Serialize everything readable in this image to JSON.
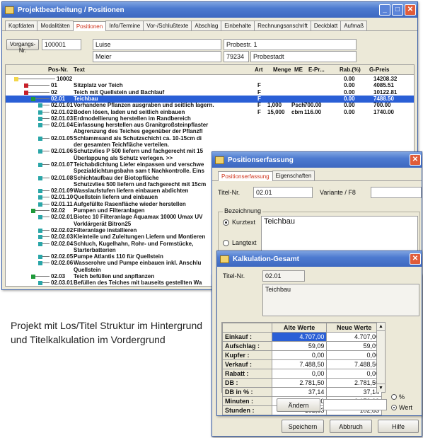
{
  "back_window": {
    "title": "Projektbearbeitung / Positionen",
    "tabs": [
      "Kopfdaten",
      "Modalitäten",
      "Positionen",
      "Info/Termine",
      "Vor-/Schlußtexte",
      "Abschlag",
      "Einbehalte",
      "Rechnungsanschrift",
      "Deckblatt",
      "Aufmaß"
    ],
    "active_tab": "Positionen",
    "vorgang_button": "Vorgangs-Nr.",
    "vorgang_nr": "100001",
    "name1": "Luise",
    "name2": "Meier",
    "strasse": "Probestr. 1",
    "plz": "79234",
    "ort": "Probestadt",
    "columns": [
      "Pos-Nr.",
      "Text",
      "Art",
      "Menge",
      "ME",
      "E-Pr...",
      "Rab.(%)",
      "G-Preis"
    ],
    "rows": [
      {
        "pos": "10002",
        "text": "",
        "art": "",
        "menge": "",
        "me": "",
        "epr": "",
        "rab": "0.00",
        "gpreis": "14208.32",
        "marker": "yellow",
        "indent": 0
      },
      {
        "pos": "01",
        "text": "Sitzplatz vor Teich",
        "art": "F",
        "menge": "",
        "me": "",
        "epr": "",
        "rab": "0.00",
        "gpreis": "4085.51",
        "marker": "red",
        "indent": 1
      },
      {
        "pos": "02",
        "text": "Teich mit Quellstein und Bachlauf",
        "art": "F",
        "menge": "",
        "me": "",
        "epr": "",
        "rab": "0.00",
        "gpreis": "10122.81",
        "marker": "red",
        "indent": 1
      },
      {
        "pos": "02.01",
        "text": "Teichbau",
        "art": "F",
        "menge": "",
        "me": "",
        "epr": "",
        "rab": "0.00",
        "gpreis": "7488.50",
        "marker": "green",
        "indent": 2,
        "selected": true
      },
      {
        "pos": "02.01.01",
        "text": "Vorhandene Pflanzen ausgraben und seitlich lagern.",
        "art": "F",
        "menge": "1,000",
        "me": "Psch",
        "epr": "700.00",
        "rab": "0.00",
        "gpreis": "700.00",
        "marker": "teal",
        "indent": 3
      },
      {
        "pos": "02.01.02",
        "text": "Boden lösen, laden und seitlich einbauen",
        "art": "F",
        "menge": "15,000",
        "me": "cbm",
        "epr": "116.00",
        "rab": "0.00",
        "gpreis": "1740.00",
        "marker": "teal",
        "indent": 3
      },
      {
        "pos": "02.01.03",
        "text": "Erdmodellierung herstellen im Randbereich",
        "art": "",
        "menge": "",
        "me": "",
        "epr": "",
        "rab": "",
        "gpreis": "",
        "marker": "teal",
        "indent": 3
      },
      {
        "pos": "02.01.04",
        "text": "Einfassung herstellen aus Granitgroßsteinpflaster",
        "art": "",
        "menge": "",
        "me": "",
        "epr": "",
        "rab": "",
        "gpreis": "",
        "marker": "teal",
        "indent": 3
      },
      {
        "pos": "",
        "text": "Abgrenzung des Teiches gegenüber der Pflanzfl",
        "art": "",
        "menge": "",
        "me": "",
        "epr": "",
        "rab": "",
        "gpreis": "",
        "marker": "",
        "indent": 3
      },
      {
        "pos": "02.01.05",
        "text": "Schlammsand als Schutzschicht ca. 10-15cm di",
        "art": "",
        "menge": "",
        "me": "",
        "epr": "",
        "rab": "",
        "gpreis": "",
        "marker": "teal",
        "indent": 3
      },
      {
        "pos": "",
        "text": "der gesamten Teichfläche verteilen.",
        "art": "",
        "menge": "",
        "me": "",
        "epr": "",
        "rab": "",
        "gpreis": "",
        "marker": "",
        "indent": 3
      },
      {
        "pos": "02.01.06",
        "text": "Schutzvlies P 500 liefern und fachgerecht mit 15",
        "art": "",
        "menge": "",
        "me": "",
        "epr": "",
        "rab": "",
        "gpreis": "",
        "marker": "teal",
        "indent": 3
      },
      {
        "pos": "",
        "text": "Überlappung als Schutz verlegen. >>",
        "art": "",
        "menge": "",
        "me": "",
        "epr": "",
        "rab": "",
        "gpreis": "",
        "marker": "",
        "indent": 3
      },
      {
        "pos": "02.01.07",
        "text": "Teichabdichtung Liefer einpassen und verschwe",
        "art": "",
        "menge": "",
        "me": "",
        "epr": "",
        "rab": "",
        "gpreis": "",
        "marker": "teal",
        "indent": 3
      },
      {
        "pos": "",
        "text": "Spezialdichtungsbahn sam t Nachkontrolle. Eins",
        "art": "",
        "menge": "",
        "me": "",
        "epr": "",
        "rab": "",
        "gpreis": "",
        "marker": "",
        "indent": 3
      },
      {
        "pos": "02.01.08",
        "text": "Schichtaufbau der Biotopfläche",
        "art": "",
        "menge": "",
        "me": "",
        "epr": "",
        "rab": "",
        "gpreis": "",
        "marker": "teal",
        "indent": 3
      },
      {
        "pos": "",
        "text": "Schutzvlies 500 liefern und fachgerecht mit 15cm",
        "art": "",
        "menge": "",
        "me": "",
        "epr": "",
        "rab": "",
        "gpreis": "",
        "marker": "",
        "indent": 3
      },
      {
        "pos": "02.01.09",
        "text": "Wasslaufstufen liefern einbauen abdichten",
        "art": "",
        "menge": "",
        "me": "",
        "epr": "",
        "rab": "",
        "gpreis": "",
        "marker": "teal",
        "indent": 3
      },
      {
        "pos": "02.01.10",
        "text": "Quellstein liefern und einbauen",
        "art": "",
        "menge": "",
        "me": "",
        "epr": "",
        "rab": "",
        "gpreis": "",
        "marker": "teal",
        "indent": 3
      },
      {
        "pos": "02.01.11",
        "text": "Aufgefüllte Rasenfläche wieder herstellen",
        "art": "",
        "menge": "",
        "me": "",
        "epr": "",
        "rab": "",
        "gpreis": "",
        "marker": "teal",
        "indent": 3
      },
      {
        "pos": "02.02",
        "text": "Pumpen und Filteranlagen",
        "art": "",
        "menge": "",
        "me": "",
        "epr": "",
        "rab": "",
        "gpreis": "",
        "marker": "green",
        "indent": 2
      },
      {
        "pos": "02.02.01",
        "text": "Biotec 10 Filteranlage Aquamax 10000 Umax UV",
        "art": "",
        "menge": "",
        "me": "",
        "epr": "",
        "rab": "",
        "gpreis": "",
        "marker": "teal",
        "indent": 3
      },
      {
        "pos": "",
        "text": "Vorklärgerät Bitron25",
        "art": "",
        "menge": "",
        "me": "",
        "epr": "",
        "rab": "",
        "gpreis": "",
        "marker": "",
        "indent": 3
      },
      {
        "pos": "02.02.02",
        "text": "Filteranlage installieren",
        "art": "",
        "menge": "",
        "me": "",
        "epr": "",
        "rab": "",
        "gpreis": "",
        "marker": "teal",
        "indent": 3
      },
      {
        "pos": "02.02.03",
        "text": "Kleinteile und Zuleitungen Liefern und Montieren",
        "art": "",
        "menge": "",
        "me": "",
        "epr": "",
        "rab": "",
        "gpreis": "",
        "marker": "teal",
        "indent": 3
      },
      {
        "pos": "02.02.04",
        "text": "Schluch, Kugelhahn, Rohr- und Formstücke,",
        "art": "",
        "menge": "",
        "me": "",
        "epr": "",
        "rab": "",
        "gpreis": "",
        "marker": "teal",
        "indent": 3
      },
      {
        "pos": "",
        "text": "Starterbatterien",
        "art": "",
        "menge": "",
        "me": "",
        "epr": "",
        "rab": "",
        "gpreis": "",
        "marker": "",
        "indent": 3
      },
      {
        "pos": "02.02.05",
        "text": "Pumpe Atlantis 110 für Quellstein",
        "art": "",
        "menge": "",
        "me": "",
        "epr": "",
        "rab": "",
        "gpreis": "",
        "marker": "teal",
        "indent": 3
      },
      {
        "pos": "02.02.06",
        "text": "Wasserohre und Pumpe einbauen inkl. Anschlu",
        "art": "",
        "menge": "",
        "me": "",
        "epr": "",
        "rab": "",
        "gpreis": "",
        "marker": "teal",
        "indent": 3
      },
      {
        "pos": "",
        "text": "Quellstein",
        "art": "",
        "menge": "",
        "me": "",
        "epr": "",
        "rab": "",
        "gpreis": "",
        "marker": "",
        "indent": 3
      },
      {
        "pos": "02.03",
        "text": "Teich befüllen und anpflanzen",
        "art": "",
        "menge": "",
        "me": "",
        "epr": "",
        "rab": "",
        "gpreis": "",
        "marker": "green",
        "indent": 2
      },
      {
        "pos": "02.03.01",
        "text": "Befüllen des Teiches mit bauseits gestellten Wa",
        "art": "",
        "menge": "",
        "me": "",
        "epr": "",
        "rab": "",
        "gpreis": "",
        "marker": "teal",
        "indent": 3
      }
    ]
  },
  "pos_window": {
    "title": "Positionserfassung",
    "tabs": [
      "Positionserfassung",
      "Eigenschaften"
    ],
    "titel_nr_label": "Titel-Nr.",
    "titel_nr_value": "02.01",
    "variante_label": "Variante / F8",
    "bezeichnung_label": "Bezeichnung",
    "radio_kurztext": "Kurztext",
    "radio_langtext": "Langtext",
    "bezeichnung_value": "Teichbau"
  },
  "calc_window": {
    "title": "Kalkulation-Gesamt",
    "titel_nr_label": "Titel-Nr.",
    "titel_nr_value": "02.01",
    "text_value": "Teichbau",
    "col_alt": "Alte Werte",
    "col_neu": "Neue Werte",
    "rows": [
      {
        "label": "Einkauf :",
        "alt": "4.707,00",
        "neu": "4.707,00"
      },
      {
        "label": "Aufschlag :",
        "alt": "59,09",
        "neu": "59,09"
      },
      {
        "label": "Kupfer :",
        "alt": "0,00",
        "neu": "0,00"
      },
      {
        "label": "Verkauf :",
        "alt": "7.488,50",
        "neu": "7.488,50"
      },
      {
        "label": "Rabatt :",
        "alt": "0,00",
        "neu": "0,00"
      },
      {
        "label": "DB :",
        "alt": "2.781,50",
        "neu": "2.781,50"
      },
      {
        "label": "DB in % :",
        "alt": "37,14",
        "neu": "37,14"
      },
      {
        "label": "Minuten :",
        "alt": "6.170,00",
        "neu": "6.170,00"
      },
      {
        "label": "Stunden :",
        "alt": "102,83",
        "neu": "102,83"
      }
    ],
    "aendern_button": "Ändern",
    "radio_percent": "%",
    "radio_wert": "Wert"
  },
  "bottom_buttons": {
    "save": "Speichern",
    "cancel": "Abbruch",
    "help": "Hilfe"
  },
  "caption": "Projekt mit Los/Titel Struktur im Hintergrund und  Titelkalkulation im Vordergrund"
}
